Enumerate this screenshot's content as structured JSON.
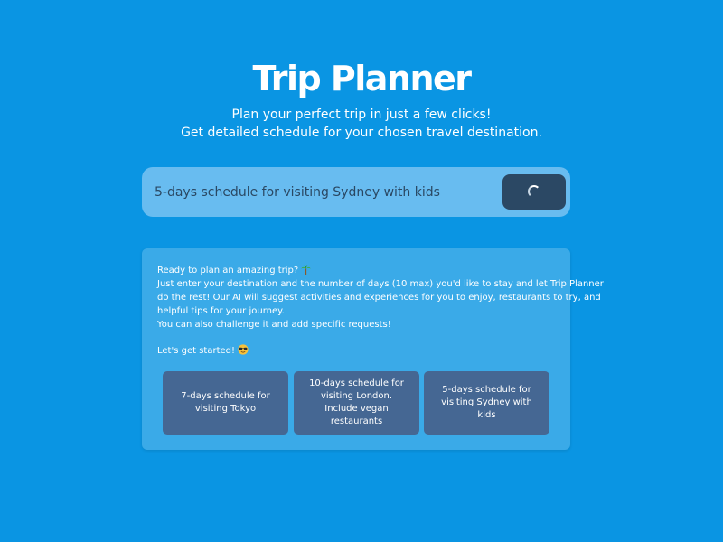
{
  "header": {
    "title": "Trip Planner",
    "subtitle_line1": "Plan your perfect trip in just a few clicks!",
    "subtitle_line2": "Get detailed schedule for your chosen travel destination."
  },
  "search": {
    "value": "5-days schedule for visiting Sydney with kids",
    "placeholder": "",
    "submit_state": "loading"
  },
  "info": {
    "line1": "Ready to plan an amazing trip?",
    "line1_icon": "palm-tree-icon",
    "line2": "Just enter your destination and the number of days (10 max) you'd like to stay and let Trip Planner",
    "line3": "do the rest! Our AI will suggest activities and experiences for you to enjoy, restaurants to try, and",
    "line4": "helpful tips for your journey.",
    "line5": "You can also challenge it and add specific requests!",
    "line6": "Let's get started!",
    "line6_icon": "sunglasses-face-icon"
  },
  "suggestions": [
    {
      "label": "7-days schedule for visiting Tokyo"
    },
    {
      "label": "10-days schedule for visiting London. Include vegan restaurants"
    },
    {
      "label": "5-days schedule for visiting Sydney with kids"
    }
  ],
  "colors": {
    "background": "#0a95e3",
    "search_bar": "#68bcf0",
    "submit_button": "#2b4864",
    "card": "#3aaae8",
    "suggestion_button": "#456793"
  }
}
